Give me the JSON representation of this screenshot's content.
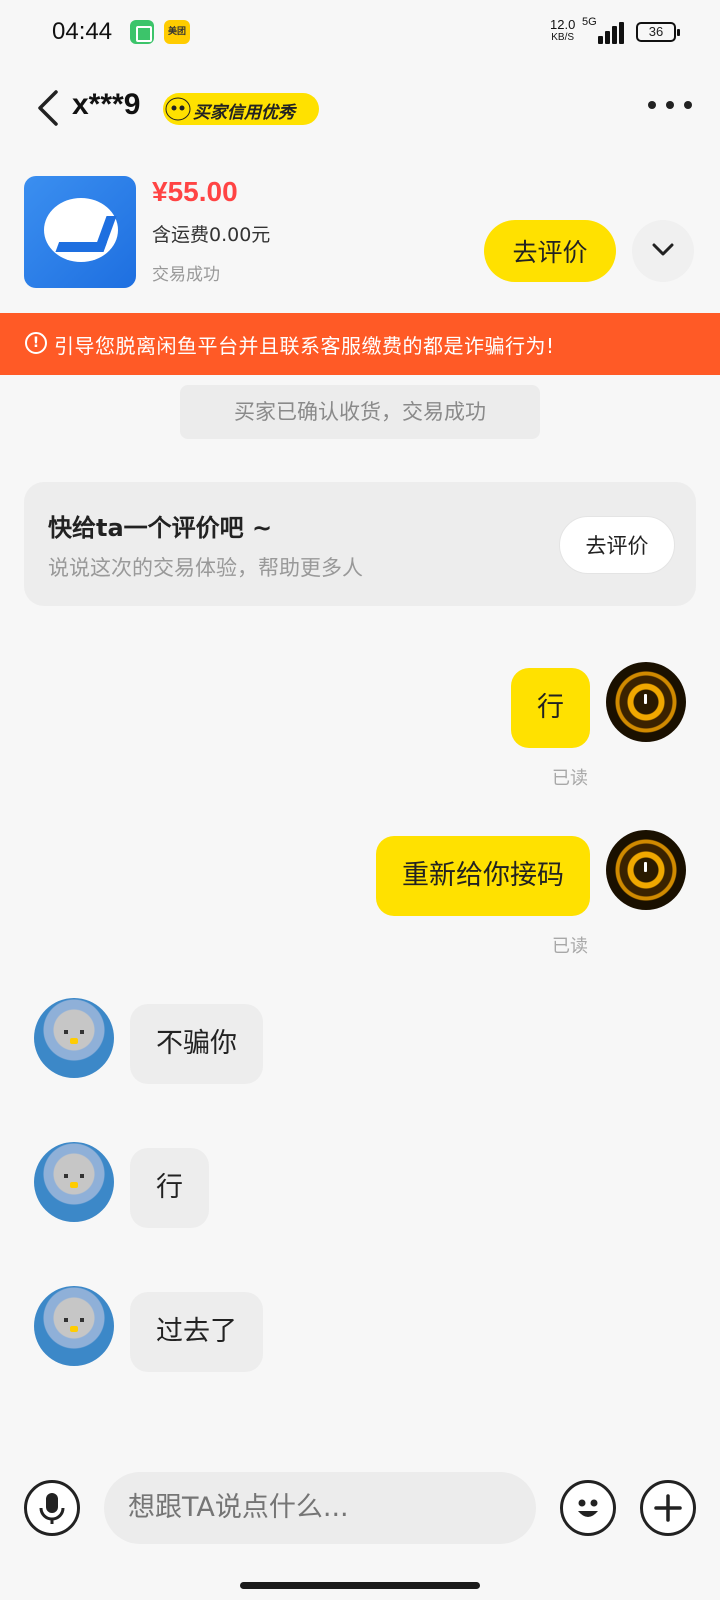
{
  "status_bar": {
    "time": "04:44",
    "app2_label": "美团",
    "net_speed": "12.0",
    "net_unit": "KB/S",
    "network": "5G",
    "battery": "36"
  },
  "nav": {
    "title": "x***9",
    "badge": "买家信用优秀"
  },
  "product": {
    "price": "¥55.00",
    "shipping": "含运费0.00元",
    "status": "交易成功",
    "review_button": "去评价"
  },
  "warning": {
    "icon": "!",
    "text": "引导您脱离闲鱼平台并且联系客服缴费的都是诈骗行为!"
  },
  "system_message": "买家已确认收货，交易成功",
  "review_card": {
    "title": "快给ta一个评价吧 ~",
    "subtitle": "说说这次的交易体验，帮助更多人",
    "button": "去评价"
  },
  "messages": [
    {
      "from": "me",
      "text": "行",
      "read": "已读"
    },
    {
      "from": "me",
      "text": "重新给你接码",
      "read": "已读"
    },
    {
      "from": "other",
      "text": "不骗你"
    },
    {
      "from": "other",
      "text": "行"
    },
    {
      "from": "other",
      "text": "过去了"
    }
  ],
  "input": {
    "placeholder": "想跟TA说点什么..."
  },
  "colors": {
    "accent": "#ffe100",
    "warning": "#ff5a26",
    "price": "#ff4444"
  }
}
